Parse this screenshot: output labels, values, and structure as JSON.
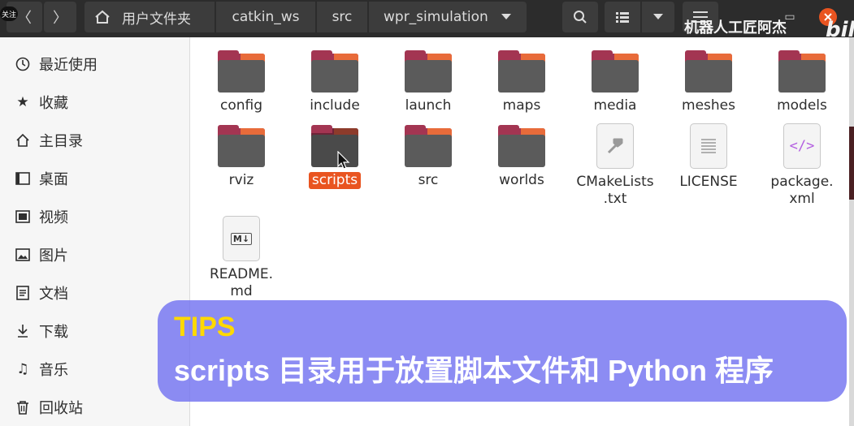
{
  "header": {
    "follow_badge": "关注",
    "back_glyph": "〈",
    "forward_glyph": "〉",
    "breadcrumbs": [
      {
        "label": "用户文件夹",
        "icon": "home-icon"
      },
      {
        "label": "catkin_ws"
      },
      {
        "label": "src"
      },
      {
        "label": "wpr_simulation",
        "icon": "chevron-down-icon"
      }
    ],
    "search_icon": "search-icon",
    "view_icon": "list-view-icon",
    "view_menu_icon": "chevron-down-icon",
    "menu_icon": "hamburger-menu-icon"
  },
  "watermark": {
    "text": "机器人工匠阿杰",
    "logo": "bili"
  },
  "sidebar": {
    "items": [
      {
        "label": "最近使用",
        "icon": "clock-icon"
      },
      {
        "label": "收藏",
        "icon": "star-icon"
      },
      {
        "label": "主目录",
        "icon": "home-icon"
      },
      {
        "label": "桌面",
        "icon": "desktop-icon"
      },
      {
        "label": "视频",
        "icon": "video-icon"
      },
      {
        "label": "图片",
        "icon": "image-icon"
      },
      {
        "label": "文档",
        "icon": "document-icon"
      },
      {
        "label": "下载",
        "icon": "download-icon"
      },
      {
        "label": "音乐",
        "icon": "music-icon"
      },
      {
        "label": "回收站",
        "icon": "trash-icon"
      }
    ]
  },
  "files": {
    "row1": [
      "config",
      "include",
      "launch",
      "maps",
      "media",
      "meshes",
      "models"
    ],
    "row2_folders": [
      "rviz",
      "scripts",
      "src",
      "worlds"
    ],
    "selected": "scripts",
    "cmake": {
      "line1": "CMakeLists",
      "line2": ".txt",
      "icon": "hammer-icon"
    },
    "license": {
      "label": "LICENSE",
      "icon": "text-file-icon"
    },
    "package": {
      "line1": "package.",
      "line2": "xml",
      "icon": "code-file-icon",
      "glyph": "</>"
    },
    "readme": {
      "line1": "README.",
      "line2": "md",
      "icon": "markdown-file-icon",
      "glyph": "M↓"
    }
  },
  "tips": {
    "title": "TIPS",
    "body": "scripts 目录用于放置脚本文件和 Python 程序"
  },
  "colors": {
    "accent": "#e95420",
    "folder_body": "#5b5b5b",
    "folder_tab": "#a33552",
    "tips_bg": "#7373f0",
    "tips_title": "#ffd900"
  }
}
